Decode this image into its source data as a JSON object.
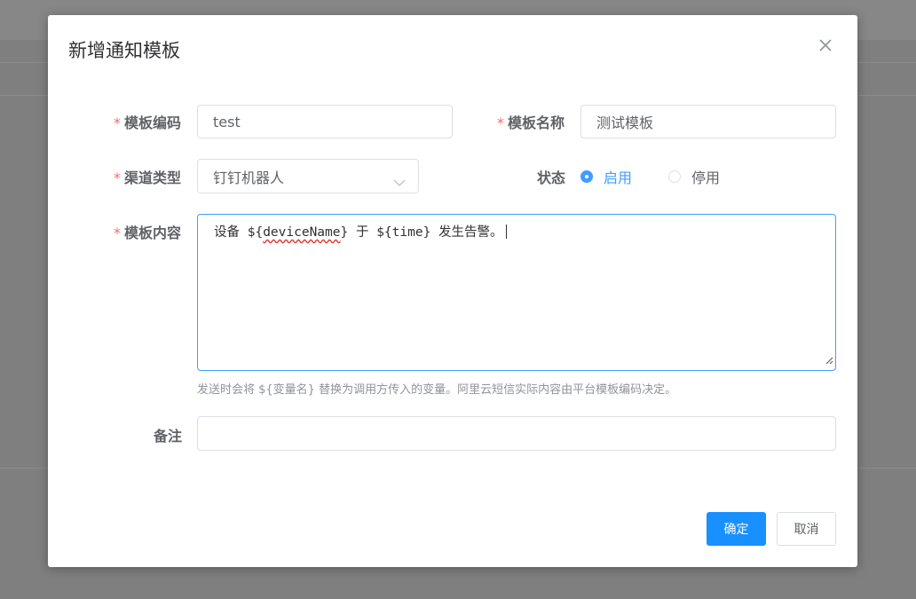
{
  "dialog": {
    "title": "新增通知模板",
    "close_icon": "close-icon"
  },
  "form": {
    "required_mark": "*",
    "code": {
      "label": "模板编码",
      "value": "test"
    },
    "name": {
      "label": "模板名称",
      "value": "测试模板"
    },
    "channel": {
      "label": "渠道类型",
      "value": "钉钉机器人",
      "icon": "chevron-down-icon"
    },
    "status": {
      "label": "状态",
      "options": [
        {
          "label": "启用",
          "selected": true
        },
        {
          "label": "停用",
          "selected": false
        }
      ]
    },
    "content": {
      "label": "模板内容",
      "value_parts": [
        "设备 ${",
        "deviceName",
        "} 于 ${time} 发生告警。"
      ],
      "hint": "发送时会将 ${变量名} 替换为调用方传入的变量。阿里云短信实际内容由平台模板编码决定。"
    },
    "remark": {
      "label": "备注",
      "value": ""
    }
  },
  "footer": {
    "confirm_label": "确定",
    "cancel_label": "取消"
  },
  "colors": {
    "primary": "#1890ff",
    "radio_active": "#409eff",
    "required": "#f56c6c"
  }
}
